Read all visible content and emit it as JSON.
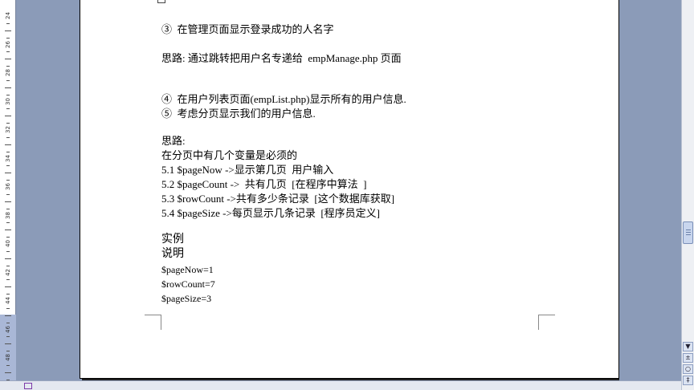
{
  "ruler": {
    "labels": [
      "24",
      "26",
      "28",
      "30",
      "32",
      "34",
      "36",
      "38",
      "40",
      "42",
      "44",
      "46",
      "48"
    ]
  },
  "document": {
    "lines": [
      "③  在管理页面显示登录成功的人名字",
      "思路: 通过跳转把用户名专递给  empManage.php 页面",
      "④  在用户列表页面(empList.php)显示所有的用户信息.",
      "⑤  考虑分页显示我们的用户信息.",
      "思路:",
      "在分页中有几个变量是必须的",
      "5.1 $pageNow ->显示第几页  用户输入",
      "5.2 $pageCount ->  共有几页  [在程序中算法  ]",
      "5.3 $rowCount ->共有多少条记录  [这个数据库获取]",
      "5.4 $pageSize ->每页显示几条记录  [程序员定义]",
      "实例",
      "说明",
      "$pageNow=1",
      "$rowCount=7",
      "$pageSize=3"
    ]
  },
  "scrollbar": {
    "up_glyph": "▲",
    "down_glyph": "▼",
    "prev_glyph": "±",
    "browse_glyph": "○",
    "next_glyph": "‡"
  }
}
